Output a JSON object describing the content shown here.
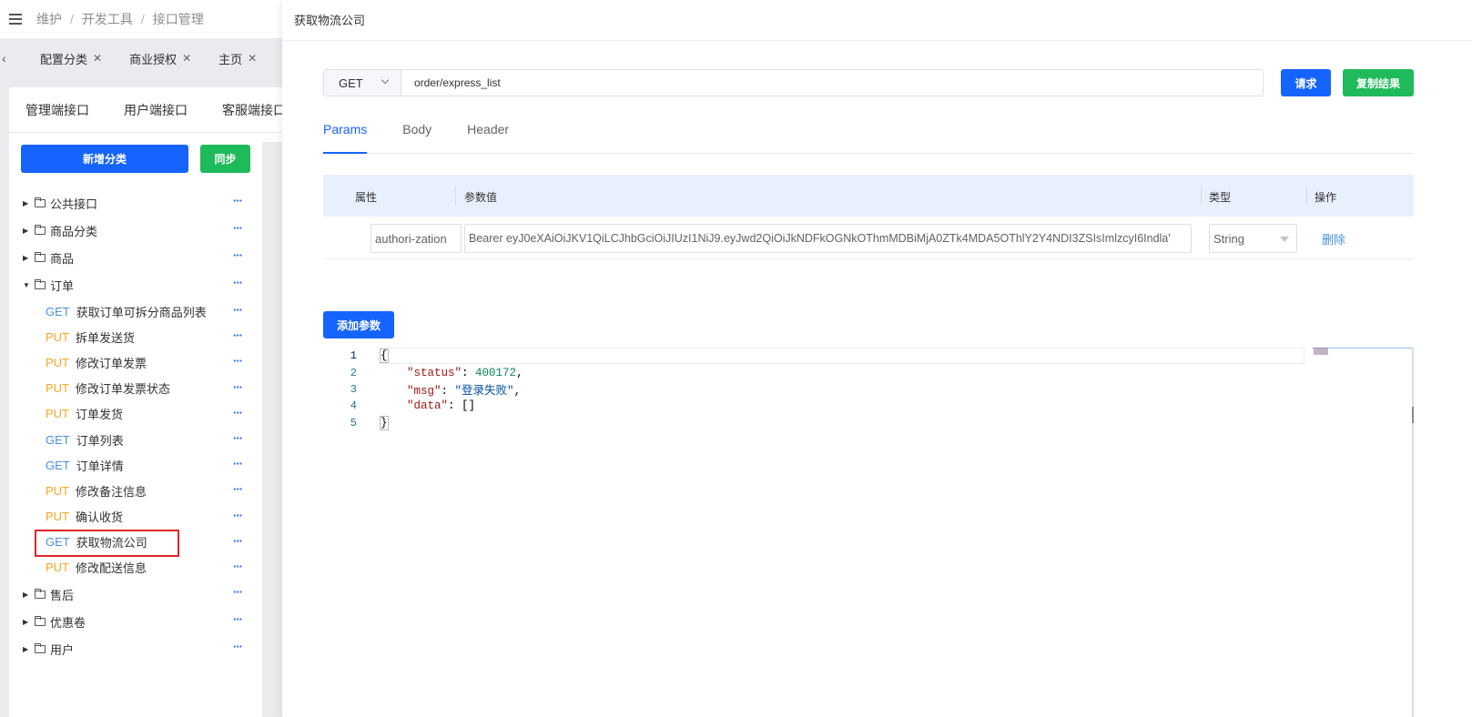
{
  "breadcrumb": [
    "维护",
    "开发工具",
    "接口管理"
  ],
  "open_tabs": [
    {
      "label": "配置分类"
    },
    {
      "label": "商业授权"
    },
    {
      "label": "主页"
    }
  ],
  "api_tabs": [
    "管理端接口",
    "用户端接口",
    "客服端接口"
  ],
  "buttons": {
    "add_category": "新增分类",
    "sync": "同步",
    "request": "请求",
    "copy_result": "复制结果",
    "add_param": "添加参数",
    "more": "···"
  },
  "tree": {
    "folders_before": [
      {
        "label": "公共接口",
        "expanded": false
      },
      {
        "label": "商品分类",
        "expanded": false
      },
      {
        "label": "商品",
        "expanded": false
      },
      {
        "label": "订单",
        "expanded": true
      }
    ],
    "order_children": [
      {
        "method": "GET",
        "label": "获取订单可拆分商品列表"
      },
      {
        "method": "PUT",
        "label": "拆单发送货"
      },
      {
        "method": "PUT",
        "label": "修改订单发票"
      },
      {
        "method": "PUT",
        "label": "修改订单发票状态"
      },
      {
        "method": "PUT",
        "label": "订单发货"
      },
      {
        "method": "GET",
        "label": "订单列表"
      },
      {
        "method": "GET",
        "label": "订单详情"
      },
      {
        "method": "PUT",
        "label": "修改备注信息"
      },
      {
        "method": "PUT",
        "label": "确认收货"
      },
      {
        "method": "GET",
        "label": "获取物流公司",
        "selected": true
      },
      {
        "method": "PUT",
        "label": "修改配送信息"
      }
    ],
    "folders_after": [
      {
        "label": "售后",
        "expanded": false
      },
      {
        "label": "优惠卷",
        "expanded": false
      },
      {
        "label": "用户",
        "expanded": false
      }
    ]
  },
  "drawer": {
    "title": "获取物流公司",
    "method": "GET",
    "url": "order/express_list",
    "tabs": [
      {
        "label": "Params",
        "active": true
      },
      {
        "label": "Body",
        "active": false
      },
      {
        "label": "Header",
        "active": false
      }
    ],
    "param_columns": [
      "属性",
      "参数值",
      "类型",
      "操作"
    ],
    "params": [
      {
        "key": "authori-zation",
        "value": "Bearer eyJ0eXAiOiJKV1QiLCJhbGciOiJIUzI1NiJ9.eyJwd2QiOiJkNDFkOGNkOThmMDBiMjA0ZTk4MDA5OThlY2Y4NDI3ZSIsImlzcyI6Indla'",
        "type": "String",
        "action": "删除"
      }
    ],
    "response_lines": [
      "1",
      "2",
      "3",
      "4",
      "5"
    ],
    "response": {
      "open": "{",
      "status_key": "\"status\"",
      "status_val": "400172",
      "msg_key": "\"msg\"",
      "msg_val": "\"登录失败\"",
      "data_key": "\"data\"",
      "data_val": "[]",
      "close": "}"
    }
  },
  "colors": {
    "primary": "#1664ff",
    "success": "#1fba5a",
    "get": "#4a90e2",
    "put": "#f5a623",
    "highlight": "#e0262a"
  }
}
